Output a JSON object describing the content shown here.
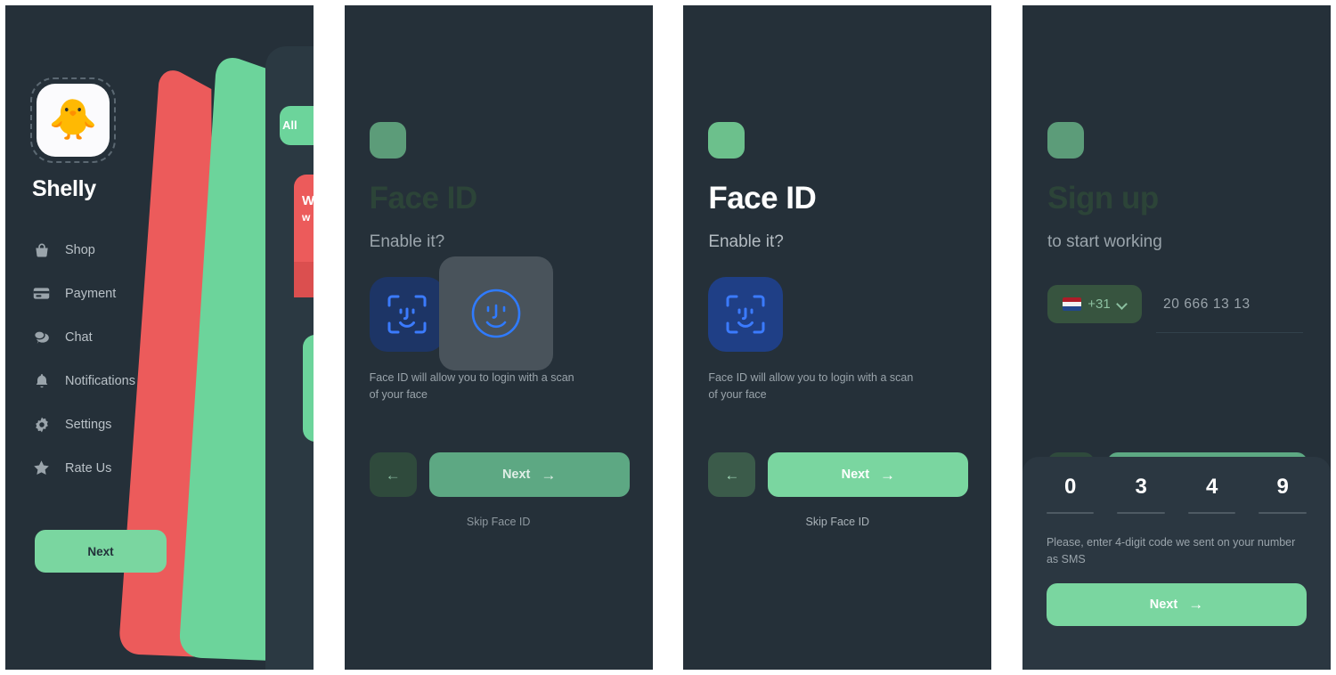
{
  "theme": {
    "bg": "#253039",
    "accent_green": "#7ad6a0",
    "accent_green_dim": "#5da883",
    "faceid_blue": "#1f3f86",
    "face_stroke": "#3b7bff",
    "card_red": "#ec5b5b",
    "card_green": "#6cd49b",
    "muted_text": "#9aa4ab"
  },
  "panel1": {
    "app_icon": "chick-emoji-icon",
    "app_icon_glyph": "🐥",
    "profile_name": "Shelly",
    "menu": [
      {
        "label": "Shop",
        "icon": "bag-icon"
      },
      {
        "label": "Payment",
        "icon": "credit-card-icon"
      },
      {
        "label": "Chat",
        "icon": "chat-bubble-icon"
      },
      {
        "label": "Notifications",
        "icon": "bell-icon"
      },
      {
        "label": "Settings",
        "icon": "gear-icon"
      },
      {
        "label": "Rate Us",
        "icon": "star-icon"
      }
    ],
    "next_label": "Next",
    "fan_cards": {
      "all_chip": "All",
      "red_line1": "W",
      "red_line2": "w"
    }
  },
  "panel2": {
    "title": "Face ID",
    "subtitle": "Enable it?",
    "description": "Face ID will allow you to login with a scan of your face",
    "faceid_icon": "face-id-icon",
    "overlay_icon": "face-circle-icon",
    "back_label": "←",
    "next_label": "Next",
    "next_arrow": "→",
    "skip_label": "Skip Face ID"
  },
  "panel3": {
    "title": "Face ID",
    "subtitle": "Enable it?",
    "description": "Face ID will allow you to login with a scan of your face",
    "faceid_icon": "face-id-icon",
    "back_label": "←",
    "next_label": "Next",
    "next_arrow": "→",
    "skip_label": "Skip Face ID"
  },
  "panel4": {
    "title": "Sign up",
    "subtitle": "to start working",
    "country_code": "+31",
    "country_flag": "netherlands-flag-icon",
    "phone_number": "20 666 13 13",
    "back_label": "←",
    "next_label": "Next",
    "next_arrow": "→",
    "otp_digits": [
      "0",
      "3",
      "4",
      "9"
    ],
    "otp_hint": "Please, enter 4-digit code we sent on your number as SMS",
    "sheet_next_label": "Next",
    "sheet_next_arrow": "→"
  }
}
